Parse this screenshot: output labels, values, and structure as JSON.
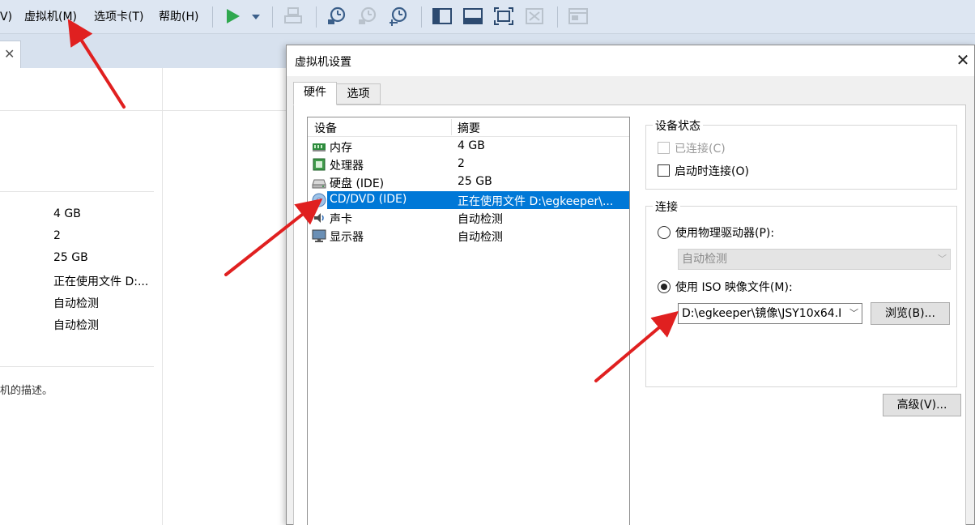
{
  "menu": {
    "items": [
      "V)",
      "虚拟机(M)",
      "选项卡(T)",
      "帮助(H)"
    ]
  },
  "background": {
    "summary_values": [
      "4 GB",
      "2",
      "25 GB",
      "正在使用文件 D:...",
      "自动检测",
      "自动检测"
    ],
    "description": "机的描述。"
  },
  "dialog": {
    "title": "虚拟机设置",
    "close": "✕",
    "tabs": [
      {
        "label": "硬件",
        "active": true
      },
      {
        "label": "选项",
        "active": false
      }
    ],
    "device_list": {
      "columns": [
        "设备",
        "摘要"
      ],
      "rows": [
        {
          "name": "内存",
          "summary": "4 GB",
          "icon": "memory-icon",
          "selected": false
        },
        {
          "name": "处理器",
          "summary": "2",
          "icon": "processor-icon",
          "selected": false
        },
        {
          "name": "硬盘 (IDE)",
          "summary": "25 GB",
          "icon": "hard-disk-icon",
          "selected": false
        },
        {
          "name": "CD/DVD (IDE)",
          "summary": "正在使用文件 D:\\egkeeper\\...",
          "icon": "cd-dvd-icon",
          "selected": true
        },
        {
          "name": "声卡",
          "summary": "自动检测",
          "icon": "sound-card-icon",
          "selected": false
        },
        {
          "name": "显示器",
          "summary": "自动检测",
          "icon": "display-icon",
          "selected": false
        }
      ]
    },
    "device_status": {
      "title": "设备状态",
      "connected_label": "已连接(C)",
      "connected_checked": false,
      "connect_at_power_on_label": "启动时连接(O)",
      "connect_at_power_on_checked": false
    },
    "connection": {
      "title": "连接",
      "physical_drive_label": "使用物理驱动器(P):",
      "physical_drive_value": "自动检测",
      "iso_label": "使用 ISO 映像文件(M):",
      "iso_path": "D:\\egkeeper\\镜像\\JSY10x64.I",
      "browse_label": "浏览(B)...",
      "selected": "iso"
    },
    "advanced_label": "高级(V)..."
  },
  "colors": {
    "selection": "#0078d7",
    "annotation_arrow": "#e02020",
    "play_green": "#2fa84f"
  }
}
